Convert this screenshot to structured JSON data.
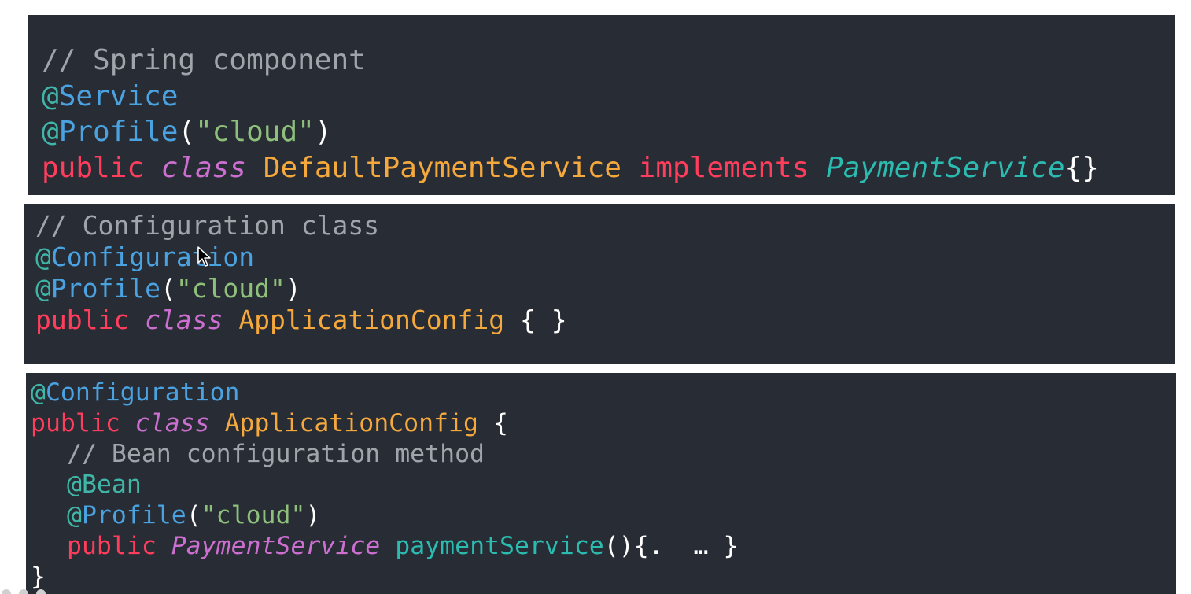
{
  "panels": [
    {
      "lines": [
        {
          "comment": "// Spring component"
        },
        {
          "at": "@",
          "name": "Service"
        },
        {
          "at": "@",
          "name": "Profile",
          "open": "(",
          "str": "\"cloud\"",
          "close": ")"
        },
        {
          "kw": "public",
          "mod": "class",
          "cls": "DefaultPaymentService",
          "kw2": "implements",
          "type": "PaymentService",
          "tail": "{}"
        }
      ]
    },
    {
      "lines": [
        {
          "comment": "// Configuration class"
        },
        {
          "at": "@",
          "name": "Configuration"
        },
        {
          "at": "@",
          "name": "Profile",
          "open": "(",
          "str": "\"cloud\"",
          "close": ")"
        },
        {
          "kw": "public",
          "mod": "class",
          "cls": "ApplicationConfig",
          "tail": "{ }"
        }
      ]
    },
    {
      "lines": [
        {
          "at": "@",
          "name": "Configuration"
        },
        {
          "kw": "public",
          "mod": "class",
          "cls": "ApplicationConfig",
          "tail": "{"
        },
        {
          "comment": "// Bean configuration method"
        },
        {
          "at": "@",
          "name": "Bean"
        },
        {
          "at": "@",
          "name": "Profile",
          "open": "(",
          "str": "\"cloud\"",
          "close": ")"
        },
        {
          "kw": "public",
          "type": "PaymentService",
          "method": "paymentService",
          "tail": "(){.  … }"
        },
        {
          "tail": "}"
        }
      ]
    }
  ],
  "colors": {
    "panel_bg": "#282c34",
    "comment": "#a0a4ab",
    "annotation": "#4aa2e0",
    "keyword": "#ff3d5c",
    "modifier": "#cc6fd0",
    "class_name": "#f5a83c",
    "type": "#2bbbb0",
    "string": "#8ec07c"
  },
  "icons": {
    "cursor": "mouse-pointer-icon"
  }
}
